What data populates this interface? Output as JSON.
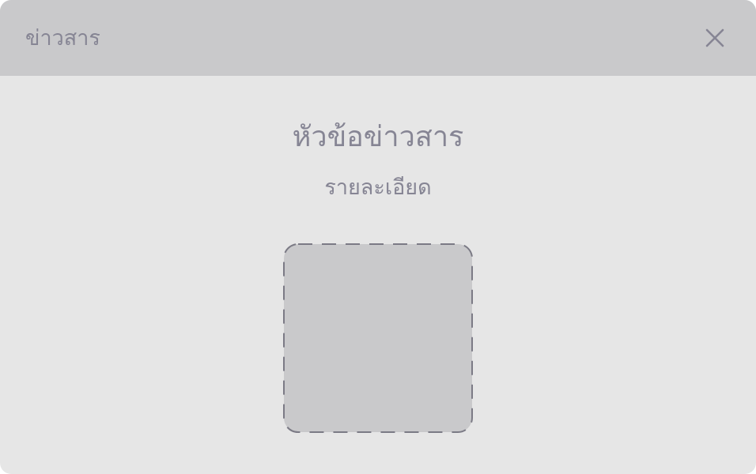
{
  "dialog": {
    "header_title": "ข่าวสาร",
    "close_icon": "close-icon"
  },
  "content": {
    "title": "หัวข้อข่าวสาร",
    "detail": "รายละเอียด",
    "image_placeholder_icon": "image-placeholder"
  },
  "colors": {
    "header_bg": "#c9c9cb",
    "body_bg": "#e6e6e6",
    "text": "#868594",
    "placeholder_fill": "#c9c9cb",
    "placeholder_border": "#7b7a85"
  }
}
